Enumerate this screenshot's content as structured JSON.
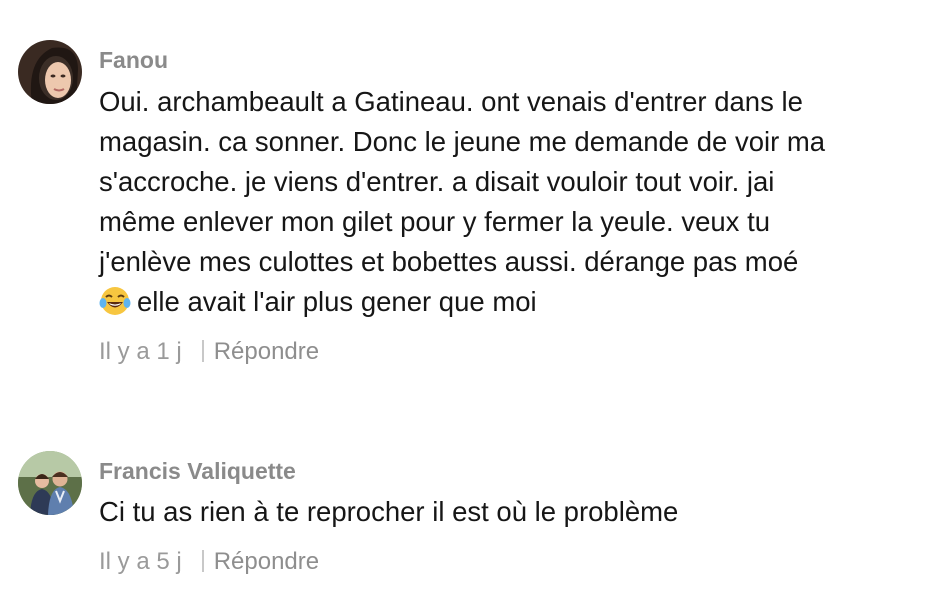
{
  "comments": [
    {
      "author": "Fanou",
      "text_lines": [
        "Oui. archambeault a Gatineau. ont venais d'entrer dans le",
        "magasin. ca sonner. Donc le jeune me demande de voir ma",
        "s'accroche. je viens d'entrer. a disait vouloir tout voir. jai",
        "même enlever mon gilet pour y fermer la yeule. veux tu",
        "j'enlève mes culottes et bobettes aussi. dérange pas moé",
        "elle avait l'air plus gener que moi"
      ],
      "emoji": "tears-of-joy-emoji",
      "time": "Il y a 1 j",
      "reply_label": "Répondre"
    },
    {
      "author": "Francis Valiquette",
      "text_lines": [
        "Ci tu as rien à te reprocher il est où le problème"
      ],
      "time": "Il y a 5 j",
      "reply_label": "Répondre"
    }
  ]
}
